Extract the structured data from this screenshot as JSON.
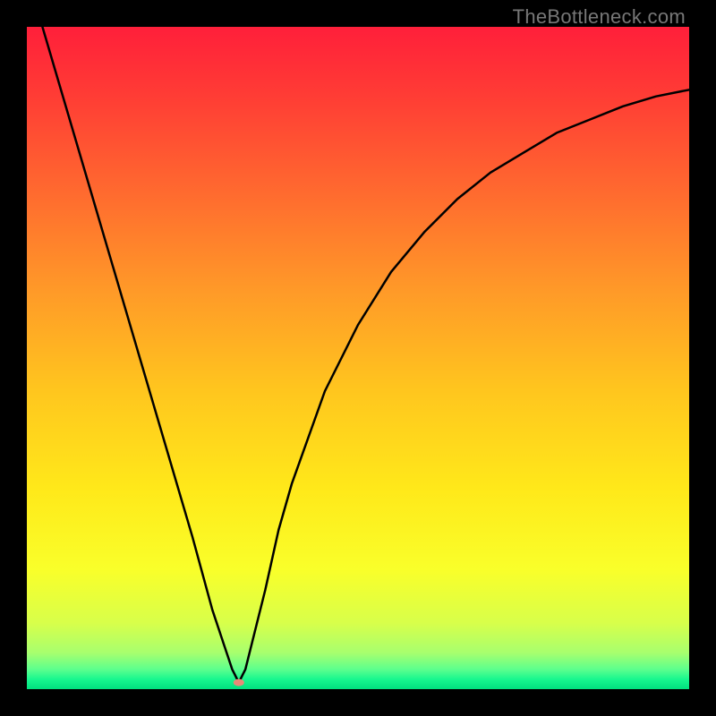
{
  "watermark": "TheBottleneck.com",
  "chart_data": {
    "type": "line",
    "title": "",
    "xlabel": "",
    "ylabel": "",
    "xlim": [
      0,
      100
    ],
    "ylim": [
      0,
      100
    ],
    "x": [
      0,
      5,
      10,
      15,
      20,
      25,
      28,
      30,
      31,
      32,
      33,
      34,
      36,
      38,
      40,
      45,
      50,
      55,
      60,
      65,
      70,
      75,
      80,
      85,
      90,
      95,
      100
    ],
    "values": [
      108,
      91,
      74,
      57,
      40,
      23,
      12,
      6,
      3,
      1,
      3,
      7,
      15,
      24,
      31,
      45,
      55,
      63,
      69,
      74,
      78,
      81,
      84,
      86,
      88,
      89.5,
      90.5
    ],
    "marker": {
      "x": 32,
      "y": 1,
      "color": "#e88a77",
      "rx": 6,
      "ry": 4
    },
    "gradient_stops": [
      {
        "offset": 0.0,
        "color": "#ff1f3a"
      },
      {
        "offset": 0.1,
        "color": "#ff3b35"
      },
      {
        "offset": 0.25,
        "color": "#ff6a2f"
      },
      {
        "offset": 0.4,
        "color": "#ff9a28"
      },
      {
        "offset": 0.55,
        "color": "#ffc61e"
      },
      {
        "offset": 0.7,
        "color": "#ffe91a"
      },
      {
        "offset": 0.82,
        "color": "#f9ff2a"
      },
      {
        "offset": 0.9,
        "color": "#d8ff4a"
      },
      {
        "offset": 0.945,
        "color": "#a8ff6e"
      },
      {
        "offset": 0.97,
        "color": "#5dff8d"
      },
      {
        "offset": 0.985,
        "color": "#18f78f"
      },
      {
        "offset": 1.0,
        "color": "#00e07f"
      }
    ]
  }
}
